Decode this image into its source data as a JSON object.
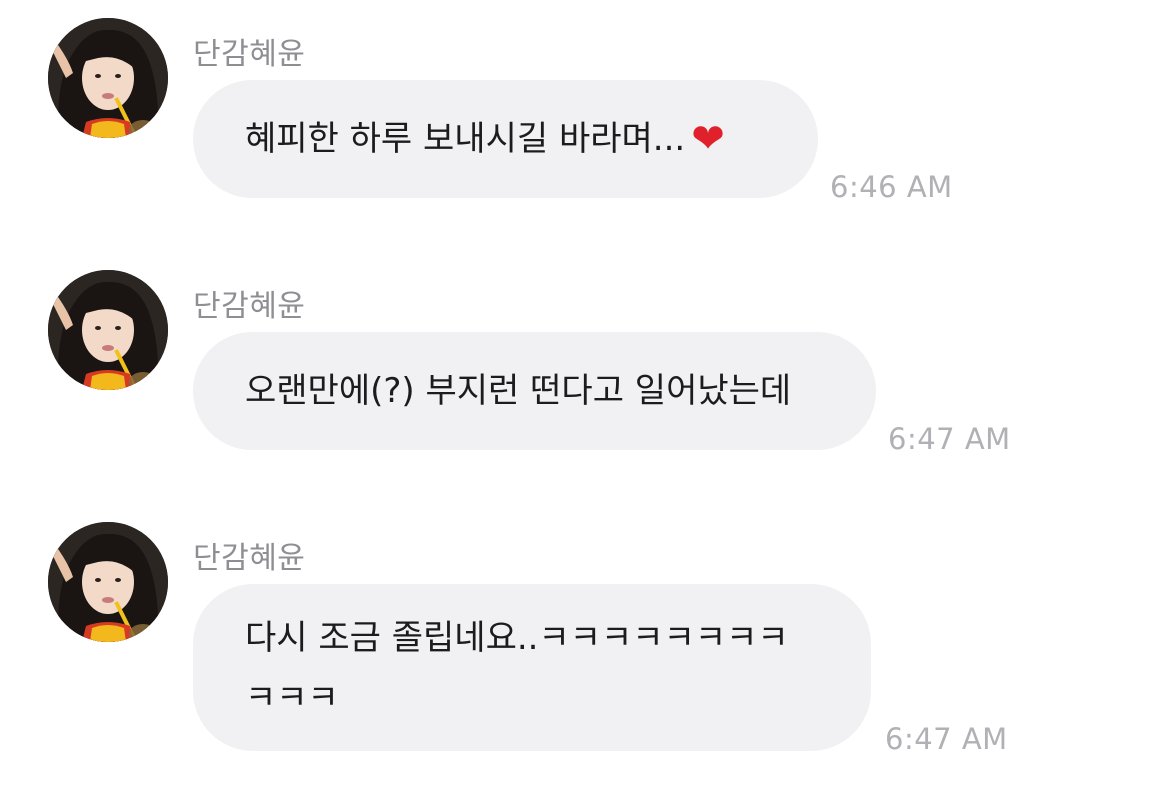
{
  "messages": [
    {
      "sender": "단감혜윤",
      "text": "혜피한 하루 보내시길 바라며...",
      "emoji": "❤",
      "time": "6:46 AM"
    },
    {
      "sender": "단감혜윤",
      "text": "오랜만에(?) 부지런 떤다고 일어났는데",
      "time": "6:47 AM"
    },
    {
      "sender": "단감혜윤",
      "text": "다시 조금 졸립네요..ㅋㅋㅋㅋㅋㅋㅋㅋ\nㅋㅋㅋ",
      "time": "6:47 AM"
    }
  ],
  "colors": {
    "bubble": "#f1f1f3",
    "sender": "#8e8e93",
    "time": "#b0b0b5",
    "heart": "#e0202a"
  }
}
